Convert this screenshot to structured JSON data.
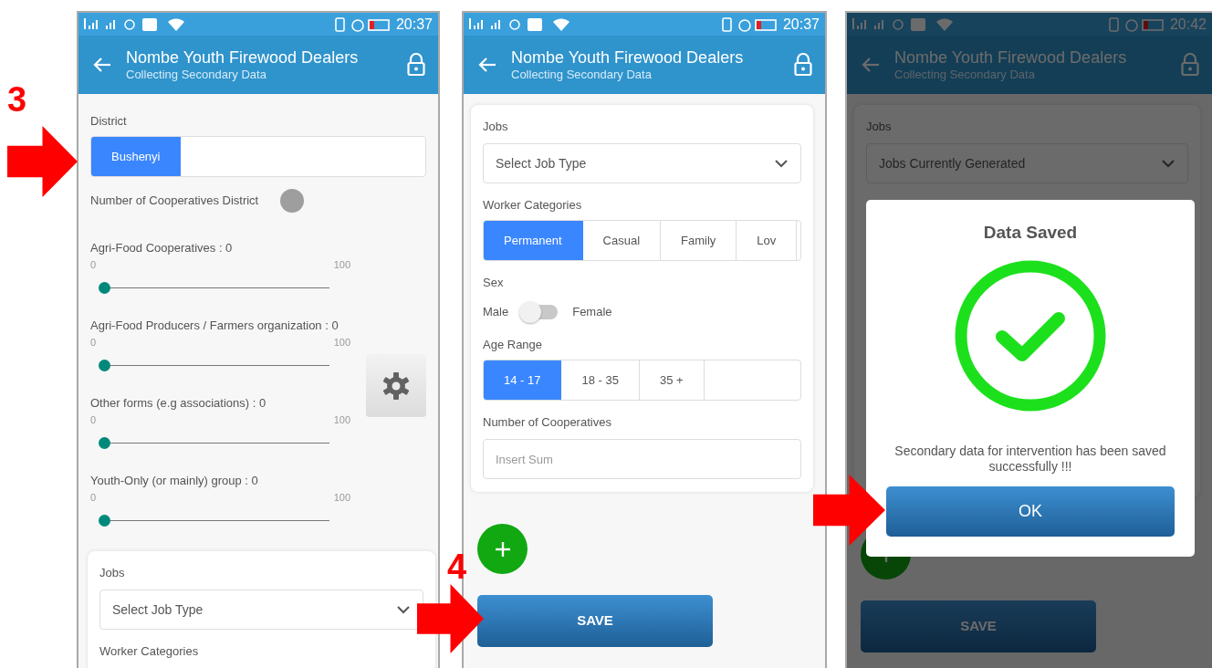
{
  "annotations": [
    {
      "kind": "number",
      "label": "3"
    },
    {
      "kind": "arrow"
    },
    {
      "kind": "number",
      "label": "4"
    },
    {
      "kind": "arrow"
    },
    {
      "kind": "arrow"
    }
  ],
  "screens": [
    {
      "dimmed": false,
      "status_bar": {
        "time": "20:37"
      },
      "app_bar": {
        "title": "Nombe Youth Firewood Dealers",
        "subtitle": "Collecting Secondary Data"
      },
      "sections": [
        {
          "kind": "segments",
          "label": "District",
          "options": [
            {
              "label": "Bushenyi",
              "selected": true
            }
          ]
        },
        {
          "kind": "toggle",
          "label": "Number of Cooperatives District",
          "on": false
        },
        {
          "kind": "slider",
          "label": "Agri-Food Cooperatives : 0",
          "min": "0",
          "max": "100",
          "level": 0
        },
        {
          "kind": "slider",
          "label": "Agri-Food Producers / Farmers organization : 0",
          "min": "0",
          "max": "100",
          "level": 0
        },
        {
          "kind": "slider",
          "label": "Other forms (e.g associations) : 0",
          "min": "0",
          "max": "100",
          "level": 0
        },
        {
          "kind": "slider",
          "label": "Youth-Only (or mainly) group : 0",
          "min": "0",
          "max": "100",
          "level": 0
        },
        {
          "kind": "card",
          "sections": [
            {
              "kind": "select",
              "label": "Jobs",
              "value": "Select Job Type"
            },
            {
              "kind": "heading",
              "label": "Worker Categories"
            }
          ]
        }
      ],
      "floating_button": {
        "kind": "settings"
      }
    },
    {
      "dimmed": false,
      "status_bar": {
        "time": "20:37"
      },
      "app_bar": {
        "title": "Nombe Youth Firewood Dealers",
        "subtitle": "Collecting Secondary Data"
      },
      "sections": [
        {
          "kind": "card",
          "sections": [
            {
              "kind": "select",
              "label": "Jobs",
              "value": "Select Job Type"
            },
            {
              "kind": "segments",
              "label": "Worker Categories",
              "options": [
                {
                  "label": "Permanent",
                  "selected": true
                },
                {
                  "label": "Casual",
                  "selected": false
                },
                {
                  "label": "Family",
                  "selected": false
                },
                {
                  "label": "Lov",
                  "selected": false
                }
              ]
            },
            {
              "kind": "switch",
              "label": "Sex",
              "left": "Male",
              "right": "Female",
              "on": false
            },
            {
              "kind": "segments",
              "label": "Age Range",
              "options": [
                {
                  "label": "14 - 17",
                  "selected": true
                },
                {
                  "label": "18 - 35",
                  "selected": false
                },
                {
                  "label": "35 +",
                  "selected": false
                }
              ]
            },
            {
              "kind": "input",
              "label": "Number of Cooperatives",
              "placeholder": "Insert Sum"
            }
          ]
        }
      ],
      "floating_button": {
        "kind": "add"
      },
      "save_button": "SAVE"
    },
    {
      "dimmed": true,
      "status_bar": {
        "time": "20:42"
      },
      "app_bar": {
        "title": "Nombe Youth Firewood Dealers",
        "subtitle": "Collecting Secondary Data"
      },
      "sections": [
        {
          "kind": "card",
          "sections": [
            {
              "kind": "select",
              "label": "Jobs",
              "value": "Jobs Currently Generated"
            }
          ]
        }
      ],
      "floating_button": {
        "kind": "add"
      },
      "save_button": "SAVE",
      "dialog": {
        "title": "Data Saved",
        "message": "Secondary data for intervention has been saved successfully !!!",
        "button": "OK"
      }
    }
  ]
}
